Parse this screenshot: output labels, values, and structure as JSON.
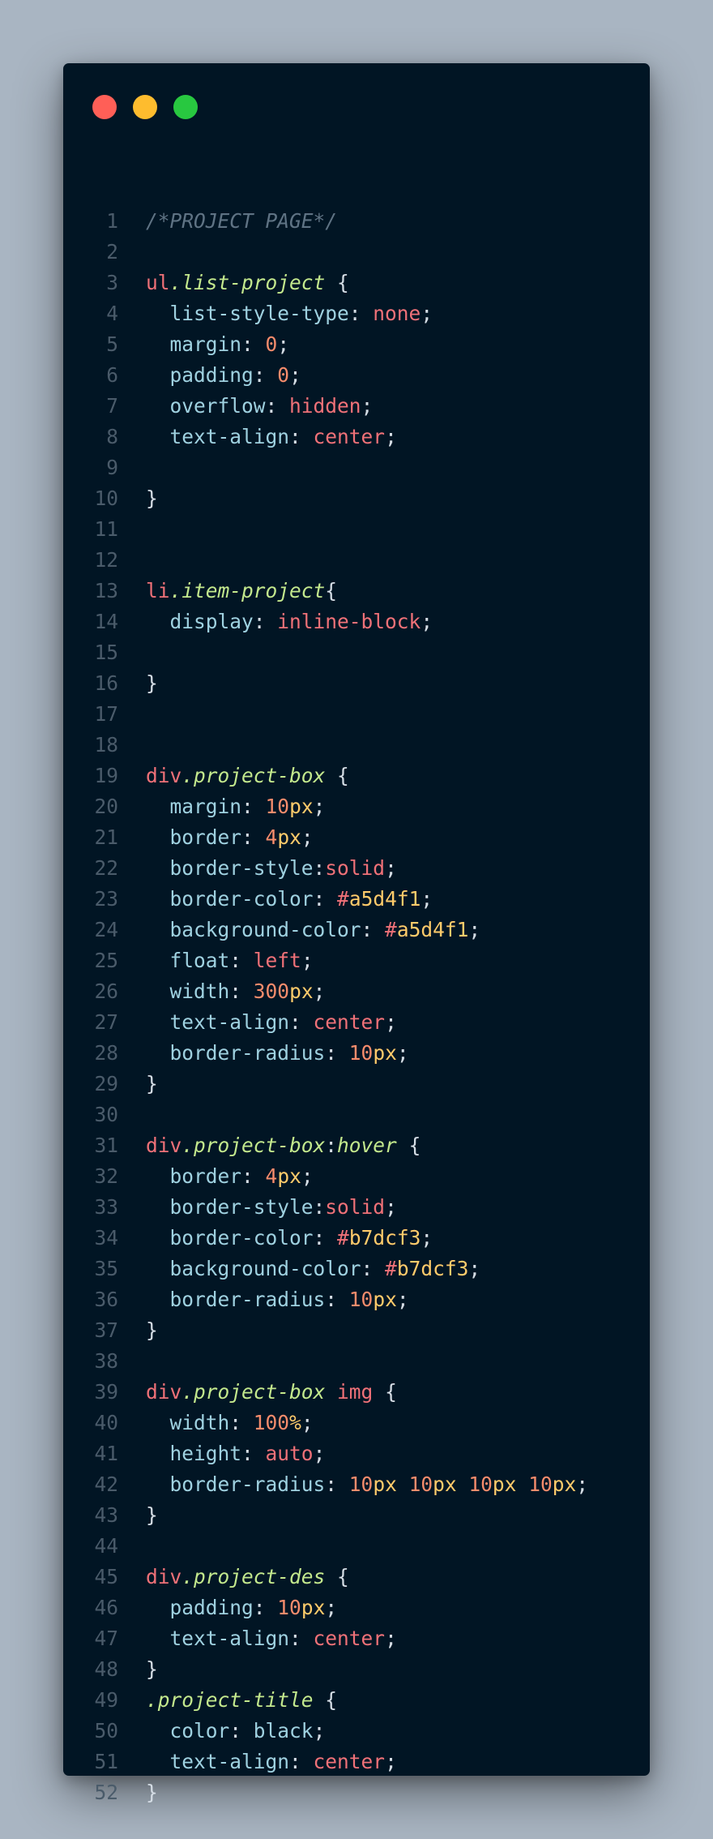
{
  "window": {
    "controls": [
      {
        "name": "close-dot",
        "color": "#ff5f57"
      },
      {
        "name": "minimize-dot",
        "color": "#febc2e"
      },
      {
        "name": "maximize-dot",
        "color": "#28c840"
      }
    ]
  },
  "code": {
    "language": "css",
    "lines": [
      [
        [
          "comment",
          "/*PROJECT PAGE*/"
        ]
      ],
      [],
      [
        [
          "tag",
          "ul"
        ],
        [
          "class",
          ".list-project"
        ],
        [
          "plain",
          " {"
        ]
      ],
      [
        [
          "plain",
          "  "
        ],
        [
          "prop",
          "list-style-type"
        ],
        [
          "plain",
          ": "
        ],
        [
          "val",
          "none"
        ],
        [
          "plain",
          ";"
        ]
      ],
      [
        [
          "plain",
          "  "
        ],
        [
          "prop",
          "margin"
        ],
        [
          "plain",
          ": "
        ],
        [
          "num",
          "0"
        ],
        [
          "plain",
          ";"
        ]
      ],
      [
        [
          "plain",
          "  "
        ],
        [
          "prop",
          "padding"
        ],
        [
          "plain",
          ": "
        ],
        [
          "num",
          "0"
        ],
        [
          "plain",
          ";"
        ]
      ],
      [
        [
          "plain",
          "  "
        ],
        [
          "prop",
          "overflow"
        ],
        [
          "plain",
          ": "
        ],
        [
          "val",
          "hidden"
        ],
        [
          "plain",
          ";"
        ]
      ],
      [
        [
          "plain",
          "  "
        ],
        [
          "prop",
          "text-align"
        ],
        [
          "plain",
          ": "
        ],
        [
          "val",
          "center"
        ],
        [
          "plain",
          ";"
        ]
      ],
      [],
      [
        [
          "plain",
          "}"
        ]
      ],
      [],
      [],
      [
        [
          "tag",
          "li"
        ],
        [
          "class",
          ".item-project"
        ],
        [
          "plain",
          "{"
        ]
      ],
      [
        [
          "plain",
          "  "
        ],
        [
          "prop",
          "display"
        ],
        [
          "plain",
          ": "
        ],
        [
          "val",
          "inline-block"
        ],
        [
          "plain",
          ";"
        ]
      ],
      [],
      [
        [
          "plain",
          "}"
        ]
      ],
      [],
      [],
      [
        [
          "tag",
          "div"
        ],
        [
          "class",
          ".project-box"
        ],
        [
          "plain",
          " {"
        ]
      ],
      [
        [
          "plain",
          "  "
        ],
        [
          "prop",
          "margin"
        ],
        [
          "plain",
          ": "
        ],
        [
          "num",
          "10"
        ],
        [
          "unit",
          "px"
        ],
        [
          "plain",
          ";"
        ]
      ],
      [
        [
          "plain",
          "  "
        ],
        [
          "prop",
          "border"
        ],
        [
          "plain",
          ": "
        ],
        [
          "num",
          "4"
        ],
        [
          "unit",
          "px"
        ],
        [
          "plain",
          ";"
        ]
      ],
      [
        [
          "plain",
          "  "
        ],
        [
          "prop",
          "border-style"
        ],
        [
          "plain",
          ":"
        ],
        [
          "val",
          "solid"
        ],
        [
          "plain",
          ";"
        ]
      ],
      [
        [
          "plain",
          "  "
        ],
        [
          "prop",
          "border-color"
        ],
        [
          "plain",
          ": "
        ],
        [
          "val",
          "#"
        ],
        [
          "hex",
          "a5d4f1"
        ],
        [
          "plain",
          ";"
        ]
      ],
      [
        [
          "plain",
          "  "
        ],
        [
          "prop",
          "background-color"
        ],
        [
          "plain",
          ": "
        ],
        [
          "val",
          "#"
        ],
        [
          "hex",
          "a5d4f1"
        ],
        [
          "plain",
          ";"
        ]
      ],
      [
        [
          "plain",
          "  "
        ],
        [
          "prop",
          "float"
        ],
        [
          "plain",
          ": "
        ],
        [
          "val",
          "left"
        ],
        [
          "plain",
          ";"
        ]
      ],
      [
        [
          "plain",
          "  "
        ],
        [
          "prop",
          "width"
        ],
        [
          "plain",
          ": "
        ],
        [
          "num",
          "300"
        ],
        [
          "unit",
          "px"
        ],
        [
          "plain",
          ";"
        ]
      ],
      [
        [
          "plain",
          "  "
        ],
        [
          "prop",
          "text-align"
        ],
        [
          "plain",
          ": "
        ],
        [
          "val",
          "center"
        ],
        [
          "plain",
          ";"
        ]
      ],
      [
        [
          "plain",
          "  "
        ],
        [
          "prop",
          "border-radius"
        ],
        [
          "plain",
          ": "
        ],
        [
          "num",
          "10"
        ],
        [
          "unit",
          "px"
        ],
        [
          "plain",
          ";"
        ]
      ],
      [
        [
          "plain",
          "}"
        ]
      ],
      [],
      [
        [
          "tag",
          "div"
        ],
        [
          "class",
          ".project-box"
        ],
        [
          "plain",
          ":"
        ],
        [
          "class",
          "hover"
        ],
        [
          "plain",
          " {"
        ]
      ],
      [
        [
          "plain",
          "  "
        ],
        [
          "prop",
          "border"
        ],
        [
          "plain",
          ": "
        ],
        [
          "num",
          "4"
        ],
        [
          "unit",
          "px"
        ],
        [
          "plain",
          ";"
        ]
      ],
      [
        [
          "plain",
          "  "
        ],
        [
          "prop",
          "border-style"
        ],
        [
          "plain",
          ":"
        ],
        [
          "val",
          "solid"
        ],
        [
          "plain",
          ";"
        ]
      ],
      [
        [
          "plain",
          "  "
        ],
        [
          "prop",
          "border-color"
        ],
        [
          "plain",
          ": "
        ],
        [
          "val",
          "#"
        ],
        [
          "hex",
          "b7dcf3"
        ],
        [
          "plain",
          ";"
        ]
      ],
      [
        [
          "plain",
          "  "
        ],
        [
          "prop",
          "background-color"
        ],
        [
          "plain",
          ": "
        ],
        [
          "val",
          "#"
        ],
        [
          "hex",
          "b7dcf3"
        ],
        [
          "plain",
          ";"
        ]
      ],
      [
        [
          "plain",
          "  "
        ],
        [
          "prop",
          "border-radius"
        ],
        [
          "plain",
          ": "
        ],
        [
          "num",
          "10"
        ],
        [
          "unit",
          "px"
        ],
        [
          "plain",
          ";"
        ]
      ],
      [
        [
          "plain",
          "}"
        ]
      ],
      [],
      [
        [
          "tag",
          "div"
        ],
        [
          "class",
          ".project-box"
        ],
        [
          "plain",
          " "
        ],
        [
          "tag",
          "img"
        ],
        [
          "plain",
          " {"
        ]
      ],
      [
        [
          "plain",
          "  "
        ],
        [
          "prop",
          "width"
        ],
        [
          "plain",
          ": "
        ],
        [
          "num",
          "100"
        ],
        [
          "unit",
          "%"
        ],
        [
          "plain",
          ";"
        ]
      ],
      [
        [
          "plain",
          "  "
        ],
        [
          "prop",
          "height"
        ],
        [
          "plain",
          ": "
        ],
        [
          "val",
          "auto"
        ],
        [
          "plain",
          ";"
        ]
      ],
      [
        [
          "plain",
          "  "
        ],
        [
          "prop",
          "border-radius"
        ],
        [
          "plain",
          ": "
        ],
        [
          "num",
          "10"
        ],
        [
          "unit",
          "px"
        ],
        [
          "plain",
          " "
        ],
        [
          "num",
          "10"
        ],
        [
          "unit",
          "px"
        ],
        [
          "plain",
          " "
        ],
        [
          "num",
          "10"
        ],
        [
          "unit",
          "px"
        ],
        [
          "plain",
          " "
        ],
        [
          "num",
          "10"
        ],
        [
          "unit",
          "px"
        ],
        [
          "plain",
          ";"
        ]
      ],
      [
        [
          "plain",
          "}"
        ]
      ],
      [],
      [
        [
          "tag",
          "div"
        ],
        [
          "class",
          ".project-des"
        ],
        [
          "plain",
          " {"
        ]
      ],
      [
        [
          "plain",
          "  "
        ],
        [
          "prop",
          "padding"
        ],
        [
          "plain",
          ": "
        ],
        [
          "num",
          "10"
        ],
        [
          "unit",
          "px"
        ],
        [
          "plain",
          ";"
        ]
      ],
      [
        [
          "plain",
          "  "
        ],
        [
          "prop",
          "text-align"
        ],
        [
          "plain",
          ": "
        ],
        [
          "val",
          "center"
        ],
        [
          "plain",
          ";"
        ]
      ],
      [
        [
          "plain",
          "}"
        ]
      ],
      [
        [
          "class",
          ".project-title"
        ],
        [
          "plain",
          " {"
        ]
      ],
      [
        [
          "plain",
          "  "
        ],
        [
          "prop",
          "color"
        ],
        [
          "plain",
          ": "
        ],
        [
          "prop",
          "black"
        ],
        [
          "plain",
          ";"
        ]
      ],
      [
        [
          "plain",
          "  "
        ],
        [
          "prop",
          "text-align"
        ],
        [
          "plain",
          ": "
        ],
        [
          "val",
          "center"
        ],
        [
          "plain",
          ";"
        ]
      ],
      [
        [
          "plain",
          "}"
        ]
      ]
    ]
  }
}
